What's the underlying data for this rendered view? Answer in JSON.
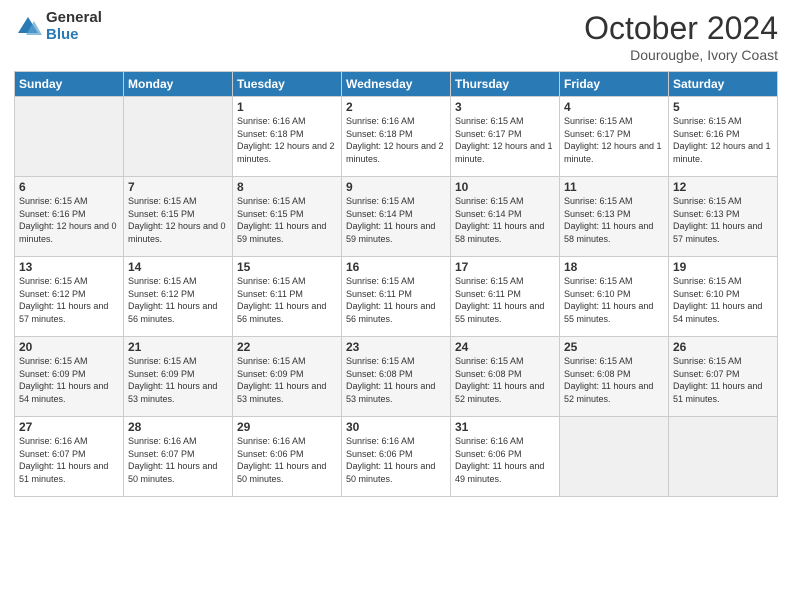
{
  "logo": {
    "general": "General",
    "blue": "Blue"
  },
  "title": "October 2024",
  "location": "Dourougbe, Ivory Coast",
  "headers": [
    "Sunday",
    "Monday",
    "Tuesday",
    "Wednesday",
    "Thursday",
    "Friday",
    "Saturday"
  ],
  "weeks": [
    [
      {
        "day": "",
        "content": ""
      },
      {
        "day": "",
        "content": ""
      },
      {
        "day": "1",
        "content": "Sunrise: 6:16 AM\nSunset: 6:18 PM\nDaylight: 12 hours\nand 2 minutes."
      },
      {
        "day": "2",
        "content": "Sunrise: 6:16 AM\nSunset: 6:18 PM\nDaylight: 12 hours\nand 2 minutes."
      },
      {
        "day": "3",
        "content": "Sunrise: 6:15 AM\nSunset: 6:17 PM\nDaylight: 12 hours\nand 1 minute."
      },
      {
        "day": "4",
        "content": "Sunrise: 6:15 AM\nSunset: 6:17 PM\nDaylight: 12 hours\nand 1 minute."
      },
      {
        "day": "5",
        "content": "Sunrise: 6:15 AM\nSunset: 6:16 PM\nDaylight: 12 hours\nand 1 minute."
      }
    ],
    [
      {
        "day": "6",
        "content": "Sunrise: 6:15 AM\nSunset: 6:16 PM\nDaylight: 12 hours\nand 0 minutes."
      },
      {
        "day": "7",
        "content": "Sunrise: 6:15 AM\nSunset: 6:15 PM\nDaylight: 12 hours\nand 0 minutes."
      },
      {
        "day": "8",
        "content": "Sunrise: 6:15 AM\nSunset: 6:15 PM\nDaylight: 11 hours\nand 59 minutes."
      },
      {
        "day": "9",
        "content": "Sunrise: 6:15 AM\nSunset: 6:14 PM\nDaylight: 11 hours\nand 59 minutes."
      },
      {
        "day": "10",
        "content": "Sunrise: 6:15 AM\nSunset: 6:14 PM\nDaylight: 11 hours\nand 58 minutes."
      },
      {
        "day": "11",
        "content": "Sunrise: 6:15 AM\nSunset: 6:13 PM\nDaylight: 11 hours\nand 58 minutes."
      },
      {
        "day": "12",
        "content": "Sunrise: 6:15 AM\nSunset: 6:13 PM\nDaylight: 11 hours\nand 57 minutes."
      }
    ],
    [
      {
        "day": "13",
        "content": "Sunrise: 6:15 AM\nSunset: 6:12 PM\nDaylight: 11 hours\nand 57 minutes."
      },
      {
        "day": "14",
        "content": "Sunrise: 6:15 AM\nSunset: 6:12 PM\nDaylight: 11 hours\nand 56 minutes."
      },
      {
        "day": "15",
        "content": "Sunrise: 6:15 AM\nSunset: 6:11 PM\nDaylight: 11 hours\nand 56 minutes."
      },
      {
        "day": "16",
        "content": "Sunrise: 6:15 AM\nSunset: 6:11 PM\nDaylight: 11 hours\nand 56 minutes."
      },
      {
        "day": "17",
        "content": "Sunrise: 6:15 AM\nSunset: 6:11 PM\nDaylight: 11 hours\nand 55 minutes."
      },
      {
        "day": "18",
        "content": "Sunrise: 6:15 AM\nSunset: 6:10 PM\nDaylight: 11 hours\nand 55 minutes."
      },
      {
        "day": "19",
        "content": "Sunrise: 6:15 AM\nSunset: 6:10 PM\nDaylight: 11 hours\nand 54 minutes."
      }
    ],
    [
      {
        "day": "20",
        "content": "Sunrise: 6:15 AM\nSunset: 6:09 PM\nDaylight: 11 hours\nand 54 minutes."
      },
      {
        "day": "21",
        "content": "Sunrise: 6:15 AM\nSunset: 6:09 PM\nDaylight: 11 hours\nand 53 minutes."
      },
      {
        "day": "22",
        "content": "Sunrise: 6:15 AM\nSunset: 6:09 PM\nDaylight: 11 hours\nand 53 minutes."
      },
      {
        "day": "23",
        "content": "Sunrise: 6:15 AM\nSunset: 6:08 PM\nDaylight: 11 hours\nand 53 minutes."
      },
      {
        "day": "24",
        "content": "Sunrise: 6:15 AM\nSunset: 6:08 PM\nDaylight: 11 hours\nand 52 minutes."
      },
      {
        "day": "25",
        "content": "Sunrise: 6:15 AM\nSunset: 6:08 PM\nDaylight: 11 hours\nand 52 minutes."
      },
      {
        "day": "26",
        "content": "Sunrise: 6:15 AM\nSunset: 6:07 PM\nDaylight: 11 hours\nand 51 minutes."
      }
    ],
    [
      {
        "day": "27",
        "content": "Sunrise: 6:16 AM\nSunset: 6:07 PM\nDaylight: 11 hours\nand 51 minutes."
      },
      {
        "day": "28",
        "content": "Sunrise: 6:16 AM\nSunset: 6:07 PM\nDaylight: 11 hours\nand 50 minutes."
      },
      {
        "day": "29",
        "content": "Sunrise: 6:16 AM\nSunset: 6:06 PM\nDaylight: 11 hours\nand 50 minutes."
      },
      {
        "day": "30",
        "content": "Sunrise: 6:16 AM\nSunset: 6:06 PM\nDaylight: 11 hours\nand 50 minutes."
      },
      {
        "day": "31",
        "content": "Sunrise: 6:16 AM\nSunset: 6:06 PM\nDaylight: 11 hours\nand 49 minutes."
      },
      {
        "day": "",
        "content": ""
      },
      {
        "day": "",
        "content": ""
      }
    ]
  ]
}
